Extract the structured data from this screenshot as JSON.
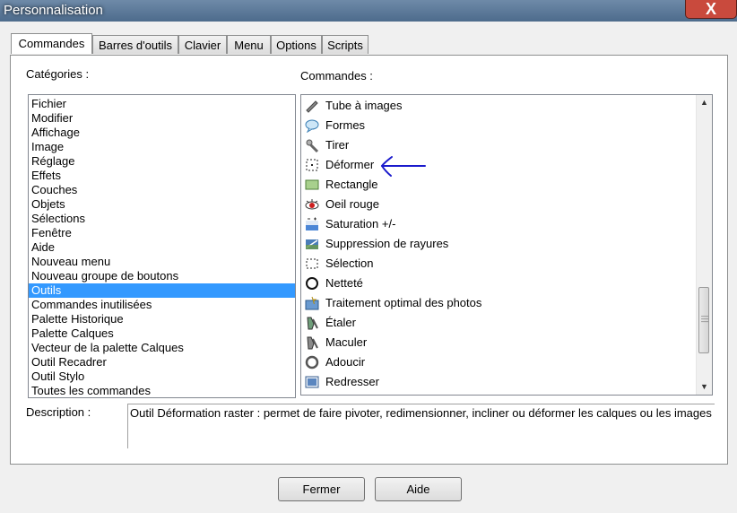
{
  "window": {
    "title": "Personnalisation",
    "close_label": "X"
  },
  "tabs": [
    "Commandes",
    "Barres d'outils",
    "Clavier",
    "Menu",
    "Options",
    "Scripts"
  ],
  "categories": {
    "label": "Catégories :",
    "items": [
      "Fichier",
      "Modifier",
      "Affichage",
      "Image",
      "Réglage",
      "Effets",
      "Couches",
      "Objets",
      "Sélections",
      "Fenêtre",
      "Aide",
      "Nouveau menu",
      "Nouveau groupe de boutons",
      "Outils",
      "Commandes inutilisées",
      "Palette Historique",
      "Palette Calques",
      "Vecteur de la palette Calques",
      "Outil Recadrer",
      "Outil Stylo",
      "Toutes les commandes"
    ],
    "selected": "Outils"
  },
  "commands": {
    "label": "Commandes :",
    "items": [
      {
        "label": "Tube à images",
        "icon": "picture-tube-icon"
      },
      {
        "label": "Formes",
        "icon": "shapes-icon"
      },
      {
        "label": "Tirer",
        "icon": "push-icon"
      },
      {
        "label": "Déformer",
        "icon": "deform-icon"
      },
      {
        "label": "Rectangle",
        "icon": "rectangle-icon"
      },
      {
        "label": "Oeil rouge",
        "icon": "red-eye-icon"
      },
      {
        "label": "Saturation +/-",
        "icon": "saturation-icon"
      },
      {
        "label": "Suppression de rayures",
        "icon": "scratch-remover-icon"
      },
      {
        "label": "Sélection",
        "icon": "selection-icon"
      },
      {
        "label": "Netteté",
        "icon": "sharpen-icon"
      },
      {
        "label": "Traitement optimal des photos",
        "icon": "photo-fix-icon"
      },
      {
        "label": "Étaler",
        "icon": "smudge-icon"
      },
      {
        "label": "Maculer",
        "icon": "smear-icon"
      },
      {
        "label": "Adoucir",
        "icon": "soften-icon"
      },
      {
        "label": "Redresser",
        "icon": "straighten-icon"
      }
    ]
  },
  "description": {
    "label": "Description :",
    "text": "Outil Déformation raster : permet de faire pivoter, redimensionner, incliner ou déformer les calques ou les images"
  },
  "buttons": {
    "close": "Fermer",
    "help": "Aide"
  },
  "colors": {
    "selection": "#3399ff",
    "annotation": "#1a1acc"
  }
}
